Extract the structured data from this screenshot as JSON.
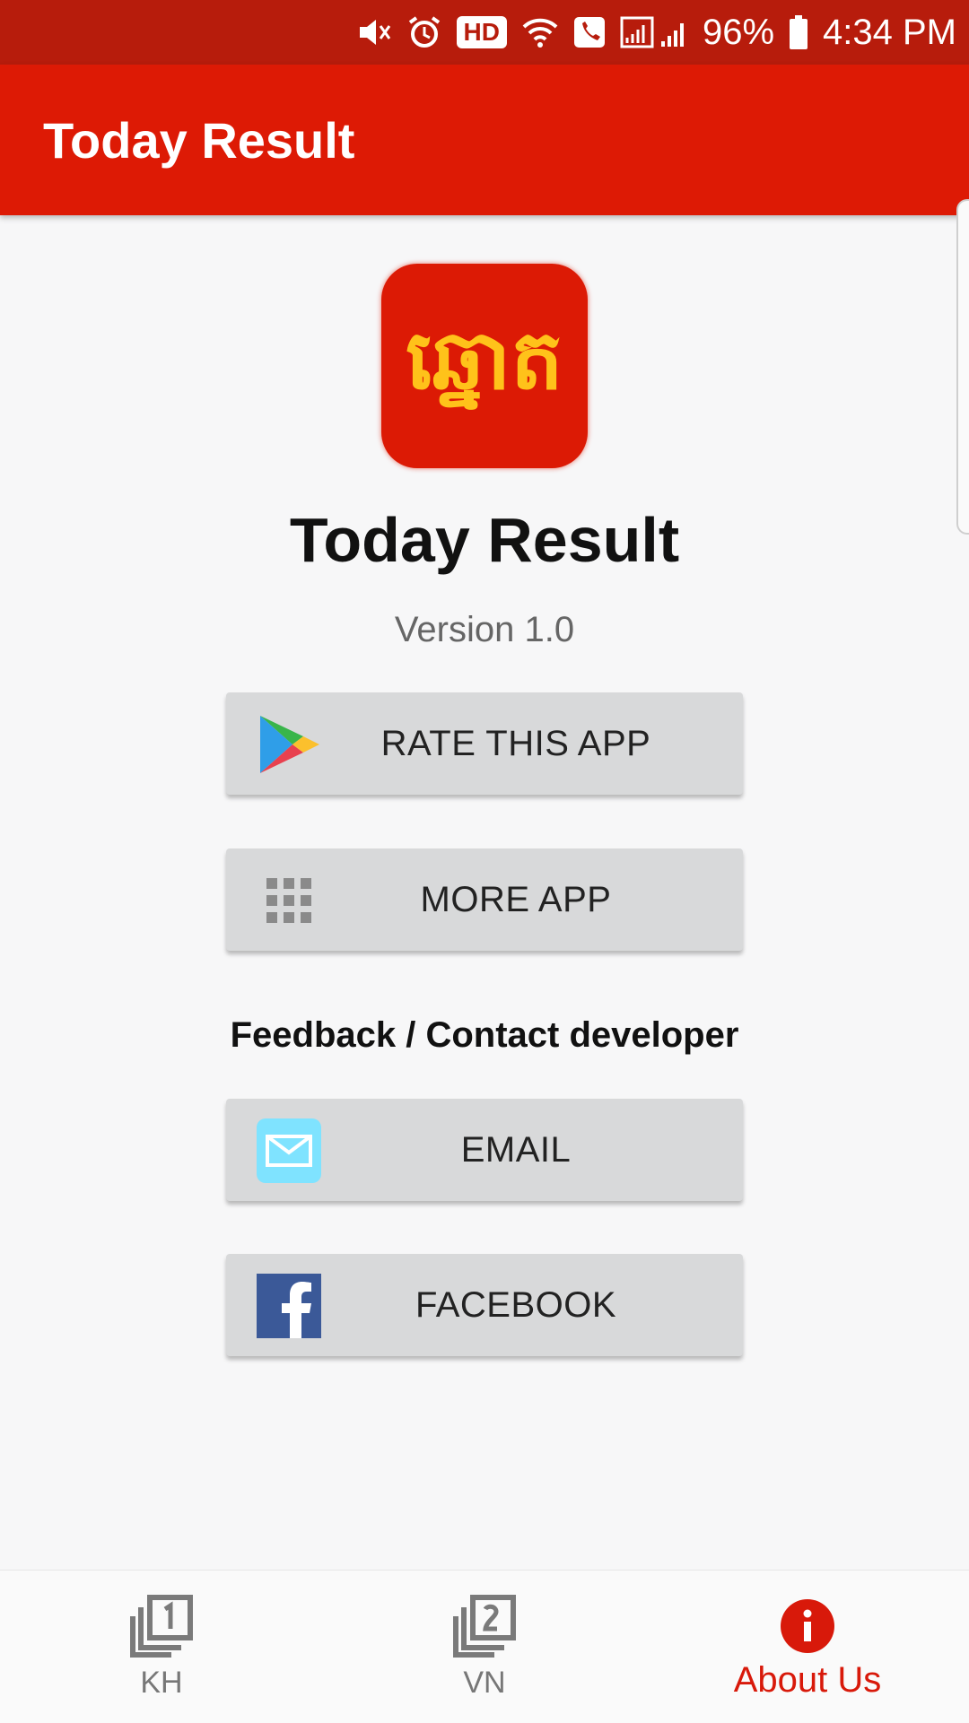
{
  "status_bar": {
    "hd_badge": "HD",
    "battery": "96%",
    "time": "4:34 PM"
  },
  "app_bar": {
    "title": "Today Result"
  },
  "logo": {
    "khmer_text": "ឆ្នោត"
  },
  "about": {
    "app_name": "Today Result",
    "version": "Version 1.0"
  },
  "buttons": {
    "rate": "RATE THIS APP",
    "more": "MORE APP",
    "email": "EMAIL",
    "facebook": "FACEBOOK"
  },
  "feedback_heading": "Feedback / Contact developer",
  "bottom_nav": {
    "kh": "KH",
    "vn": "VN",
    "about": "About Us"
  },
  "colors": {
    "primary": "#dd1a05",
    "status_bar": "#b71c0c",
    "logo_text": "#ffc21a",
    "active_nav": "#d8190a"
  },
  "icons": [
    "mute-icon",
    "alarm-icon",
    "wifi-icon",
    "call-icon",
    "signal-icon",
    "battery-icon",
    "play-store-icon",
    "apps-grid-icon",
    "email-icon",
    "facebook-icon",
    "layers-1-icon",
    "layers-2-icon",
    "info-icon"
  ]
}
